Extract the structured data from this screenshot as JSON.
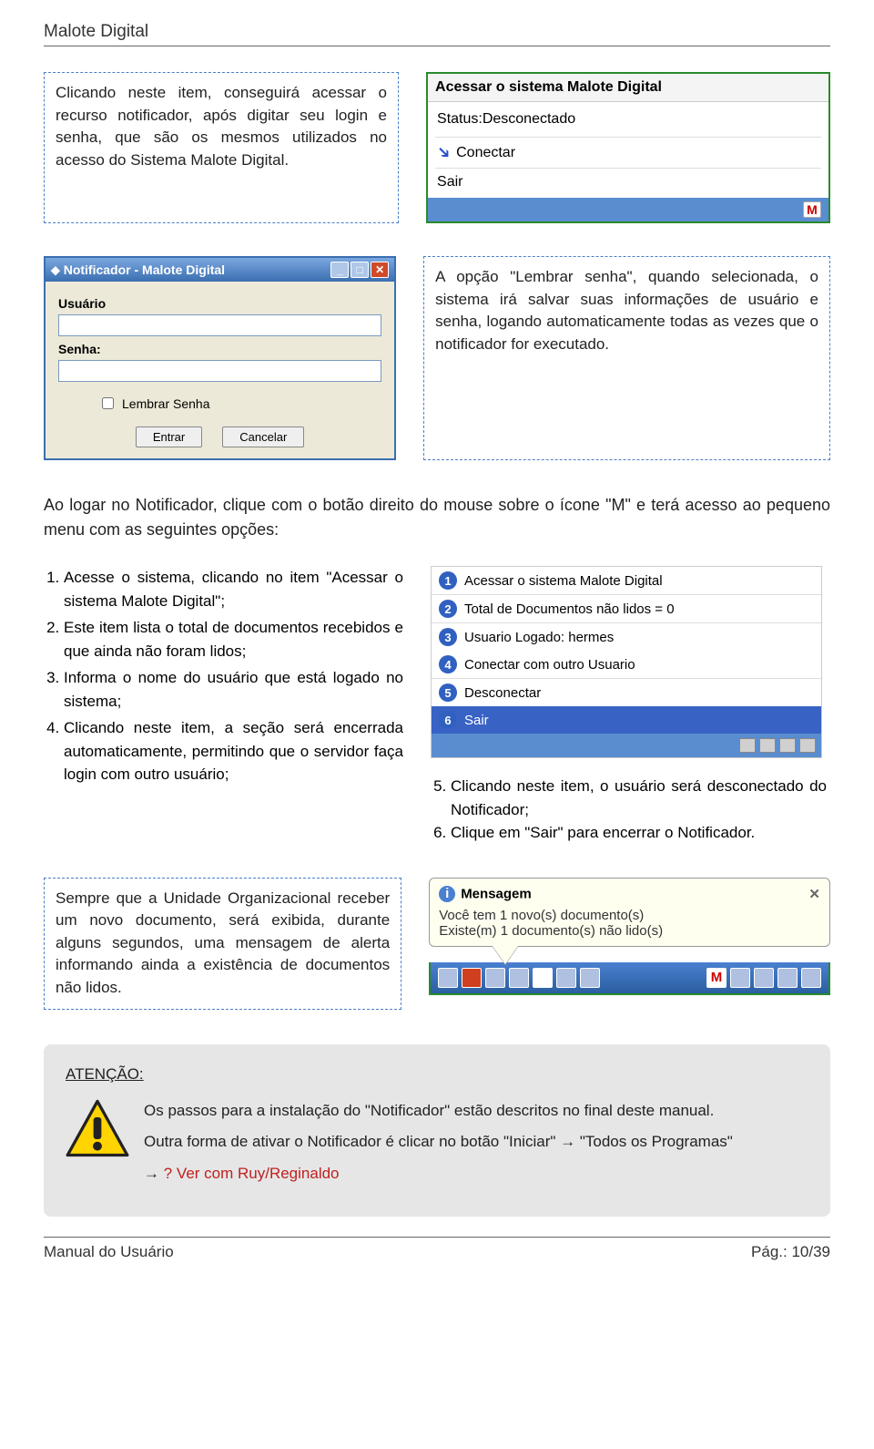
{
  "header_title": "Malote Digital",
  "callout1": "Clicando neste item, conseguirá acessar o recurso notificador, após digitar seu login e senha, que são os mesmos utilizados no acesso do Sistema Malote Digital.",
  "menu1": {
    "title": "Acessar o sistema Malote Digital",
    "status": "Status:Desconectado",
    "connect": "Conectar",
    "exit": "Sair",
    "m_badge": "M"
  },
  "login": {
    "title": "Notificador - Malote Digital",
    "user_label": "Usuário",
    "pass_label": "Senha:",
    "remember": "Lembrar Senha",
    "enter": "Entrar",
    "cancel": "Cancelar"
  },
  "callout2": "A opção \"Lembrar senha\", quando selecionada, o sistema irá salvar suas informações de usuário e senha, logando automaticamente todas as vezes que o notificador for executado.",
  "paragraph1": "Ao logar no Notificador, clique com o botão direito do mouse sobre o ícone \"M\" e terá acesso ao pequeno menu com as seguintes opções:",
  "left_list": {
    "i1": "Acesse o sistema, clicando no item \"Acessar o sistema Malote Digital\";",
    "i2": "Este item lista o total de documentos recebidos e que ainda não foram lidos;",
    "i3": "Informa o nome do usuário que está logado no sistema;",
    "i4": "Clicando neste item, a seção será encerrada automaticamente, permitindo que o servidor faça login com outro usuário;"
  },
  "num_menu": {
    "r1": "Acessar o sistema Malote Digital",
    "r2": "Total de Documentos não lidos = 0",
    "r3": "Usuario Logado: hermes",
    "r4": "Conectar com outro Usuario",
    "r5": "Desconectar",
    "r6": "Sair"
  },
  "right_list": {
    "i5": "Clicando neste item, o usuário será desconectado do Notificador;",
    "i6": "Clique em \"Sair\" para encerrar o Notificador."
  },
  "callout3": "Sempre que a Unidade Organizacional receber um novo documento, será exibida, durante alguns segundos, uma mensagem de alerta informando ainda a existência de documentos não lidos.",
  "msg": {
    "title": "Mensagem",
    "line1": "Você tem 1 novo(s) documento(s)",
    "line2": "Existe(m) 1 documento(s) não lido(s)"
  },
  "attention": {
    "label": "ATENÇÃO:",
    "p1": "Os passos para a instalação do \"Notificador\" estão descritos no final deste manual.",
    "p2a": "Outra forma de ativar o Notificador é clicar no botão \"Iniciar\" ",
    "arrow": "→",
    "p2b": " \"Todos os Programas\" ",
    "p3": "? Ver com Ruy/Reginaldo"
  },
  "footer": {
    "left": "Manual do Usuário",
    "right": "Pág.: 10/39"
  }
}
